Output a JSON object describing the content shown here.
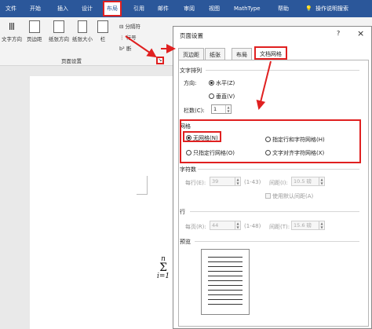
{
  "menu": {
    "tabs": [
      "文件",
      "开始",
      "插入",
      "设计",
      "布局",
      "引用",
      "邮件",
      "审阅",
      "视图",
      "MathType",
      "帮助",
      "操作说明搜索"
    ]
  },
  "ribbon": {
    "buttons": [
      "文字方向",
      "页边距",
      "纸张方向",
      "纸张大小",
      "栏"
    ],
    "small_commands": [
      "分隔符",
      "行号",
      "断"
    ],
    "group_label": "页面设置"
  },
  "formula": {
    "top": "n",
    "symbol": "Σ",
    "bottom": "i=1"
  },
  "dialog": {
    "title": "页面设置",
    "help": "?",
    "close": "×",
    "tabs": [
      "页边距",
      "纸张",
      "布局",
      "文档网格"
    ],
    "text_direction": {
      "section": "文字排列",
      "direction_label": "方向:",
      "horizontal": "水平(Z)",
      "vertical": "垂直(V)",
      "columns_label": "栏数(C):",
      "columns_value": "1"
    },
    "grid": {
      "section": "网格",
      "no_grid": "无网格(N)",
      "line_only": "只指定行网格(O)",
      "line_and_char": "指定行和字符网格(H)",
      "snap_chars": "文字对齐字符网格(X)"
    },
    "characters": {
      "section": "字符数",
      "per_line_label": "每行(E):",
      "per_line_value": "39",
      "per_line_range": "(1-43)",
      "pitch_label": "间距(I):",
      "pitch_value": "10.5 磅",
      "default_pitch": "使用默认间距(A)"
    },
    "lines": {
      "section": "行",
      "per_page_label": "每页(R):",
      "per_page_value": "44",
      "per_page_range": "(1-48)",
      "pitch_label": "间距(T):",
      "pitch_value": "15.6 磅"
    },
    "preview": {
      "section": "预览"
    }
  },
  "colors": {
    "menubar": "#2b579a",
    "highlight": "#e02020"
  }
}
